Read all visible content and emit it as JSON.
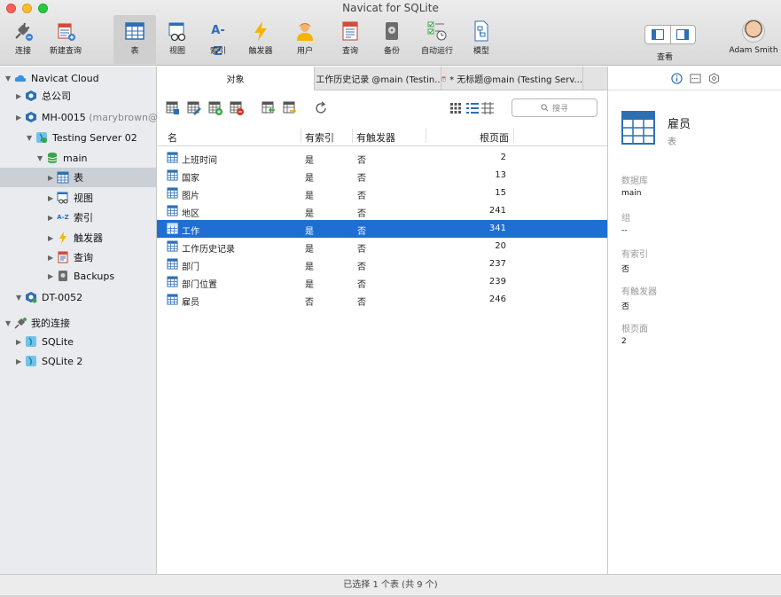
{
  "window": {
    "title": "Navicat for SQLite"
  },
  "toolbar": {
    "connect": "连接",
    "new_query": "新建查询",
    "table": "表",
    "view": "视图",
    "index": "索引",
    "trigger": "触发器",
    "user": "用户",
    "query": "查询",
    "backup": "备份",
    "automation": "自动运行",
    "model": "模型",
    "view_toggle": "查看",
    "user_name": "Adam Smith",
    "index_icon_text": "A-Z"
  },
  "sidebar": {
    "navicat_cloud": "Navicat Cloud",
    "head_office": "总公司",
    "mh_name": "MH-0015",
    "mh_email": "(marybrown@gmai...",
    "testing_server": "Testing Server 02",
    "main": "main",
    "tables": "表",
    "views": "视图",
    "indexes": "索引",
    "triggers": "触发器",
    "queries": "查询",
    "backups": "Backups",
    "dt": "DT-0052",
    "my_connections": "我的连接",
    "sqlite": "SQLite",
    "sqlite2": "SQLite 2",
    "index_icon_text": "A-Z"
  },
  "tabs": [
    {
      "label": "对象"
    },
    {
      "label": "工作历史记录 @main (Testin..."
    },
    {
      "label": "* 无标题@main (Testing Serv..."
    }
  ],
  "objbar": {
    "search_placeholder": "搜寻"
  },
  "grid": {
    "headers": {
      "name": "名",
      "has_index": "有索引",
      "has_trigger": "有触发器",
      "root_page": "根页面"
    },
    "rows": [
      {
        "name": "上班时间",
        "idx": "是",
        "trg": "否",
        "page": "2"
      },
      {
        "name": "国家",
        "idx": "是",
        "trg": "否",
        "page": "13"
      },
      {
        "name": "图片",
        "idx": "是",
        "trg": "否",
        "page": "15"
      },
      {
        "name": "地区",
        "idx": "是",
        "trg": "否",
        "page": "241"
      },
      {
        "name": "工作",
        "idx": "是",
        "trg": "否",
        "page": "341"
      },
      {
        "name": "工作历史记录",
        "idx": "是",
        "trg": "否",
        "page": "20"
      },
      {
        "name": "部门",
        "idx": "是",
        "trg": "否",
        "page": "237"
      },
      {
        "name": "部门位置",
        "idx": "是",
        "trg": "否",
        "page": "239"
      },
      {
        "name": "雇员",
        "idx": "否",
        "trg": "否",
        "page": "246"
      }
    ]
  },
  "info": {
    "name": "雇员",
    "type": "表",
    "db_label": "数据库",
    "db_value": "main",
    "group_label": "组",
    "group_value": "--",
    "idx_label": "有索引",
    "idx_value": "否",
    "trg_label": "有触发器",
    "trg_value": "否",
    "root_label": "根页面",
    "root_value": "2"
  },
  "status": {
    "text": "已选择 1 个表 (共 9 个)"
  },
  "colors": {
    "selection": "#1f6ed4",
    "table_icon": "#2d6fb3",
    "trigger": "#f5b400",
    "green": "#3aa348"
  }
}
